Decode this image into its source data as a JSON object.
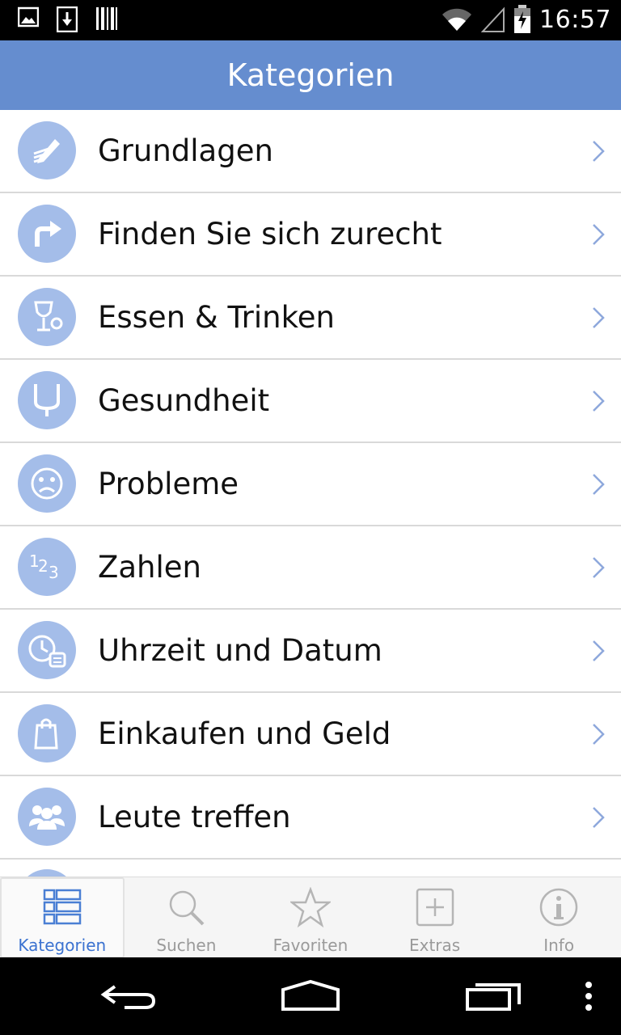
{
  "status_bar": {
    "time": "16:57",
    "icons": [
      "image-icon",
      "download-icon",
      "barcode-icon",
      "wifi-icon",
      "signal-icon",
      "battery-icon"
    ]
  },
  "header": {
    "title": "Kategorien"
  },
  "categories": [
    {
      "label": "Grundlagen",
      "icon": "pen-icon"
    },
    {
      "label": "Finden Sie sich zurecht",
      "icon": "turn-right-arrow-icon"
    },
    {
      "label": "Essen & Trinken",
      "icon": "wine-glass-icon"
    },
    {
      "label": "Gesundheit",
      "icon": "stethoscope-icon"
    },
    {
      "label": "Probleme",
      "icon": "sad-face-icon"
    },
    {
      "label": "Zahlen",
      "icon": "numbers-icon"
    },
    {
      "label": "Uhrzeit und Datum",
      "icon": "clock-calendar-icon"
    },
    {
      "label": "Einkaufen und Geld",
      "icon": "shopping-bag-icon"
    },
    {
      "label": "Leute treffen",
      "icon": "people-icon"
    }
  ],
  "tabs": [
    {
      "label": "Kategorien",
      "icon": "list-grid-icon",
      "active": true
    },
    {
      "label": "Suchen",
      "icon": "search-icon",
      "active": false
    },
    {
      "label": "Favoriten",
      "icon": "star-icon",
      "active": false
    },
    {
      "label": "Extras",
      "icon": "plus-box-icon",
      "active": false
    },
    {
      "label": "Info",
      "icon": "info-icon",
      "active": false
    }
  ],
  "colors": {
    "header_bg": "#658dcf",
    "icon_circle": "#a4bde9",
    "active_tab_text": "#3b72d0",
    "inactive_tab_text": "#9a9a9a"
  }
}
